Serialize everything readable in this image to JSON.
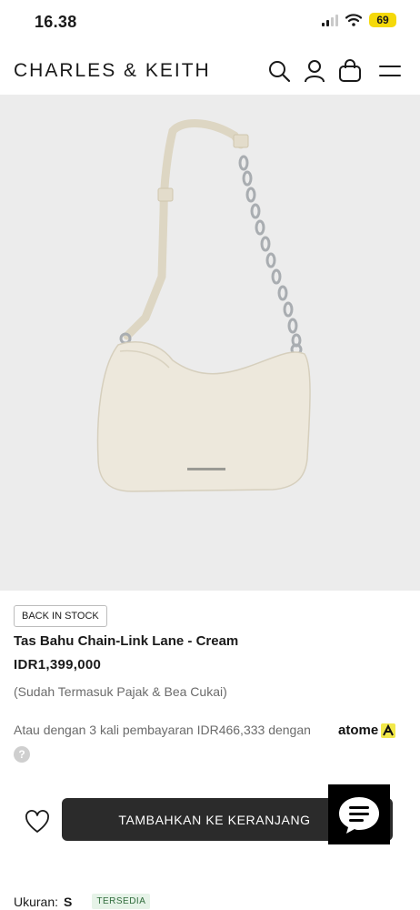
{
  "status_bar": {
    "time": "16.38",
    "battery": "69"
  },
  "header": {
    "brand": "CHARLES & KEITH",
    "icons": [
      "search-icon",
      "account-icon",
      "shopping-bag-icon",
      "menu-icon"
    ]
  },
  "product": {
    "image_icon": "shoulder-bag-image",
    "badge": "BACK IN STOCK",
    "title": "Tas Bahu Chain-Link Lane - Cream",
    "price": "IDR1,399,000",
    "tax_note": "(Sudah Termasuk Pajak & Bea Cukai)",
    "installment_text": "Atau dengan 3 kali pembayaran IDR466,333 dengan",
    "installment_provider": "atome",
    "help_label": "?"
  },
  "actions": {
    "add_to_cart_label": "TAMBAHKAN KE KERANJANG"
  },
  "size": {
    "label": "Ukuran:",
    "value": "S",
    "availability": "TERSEDIA"
  },
  "colors": {
    "button": "#2b2b2b",
    "hero_bg": "#ececec",
    "battery": "#f5d90a",
    "atome": "#f2e84a"
  }
}
